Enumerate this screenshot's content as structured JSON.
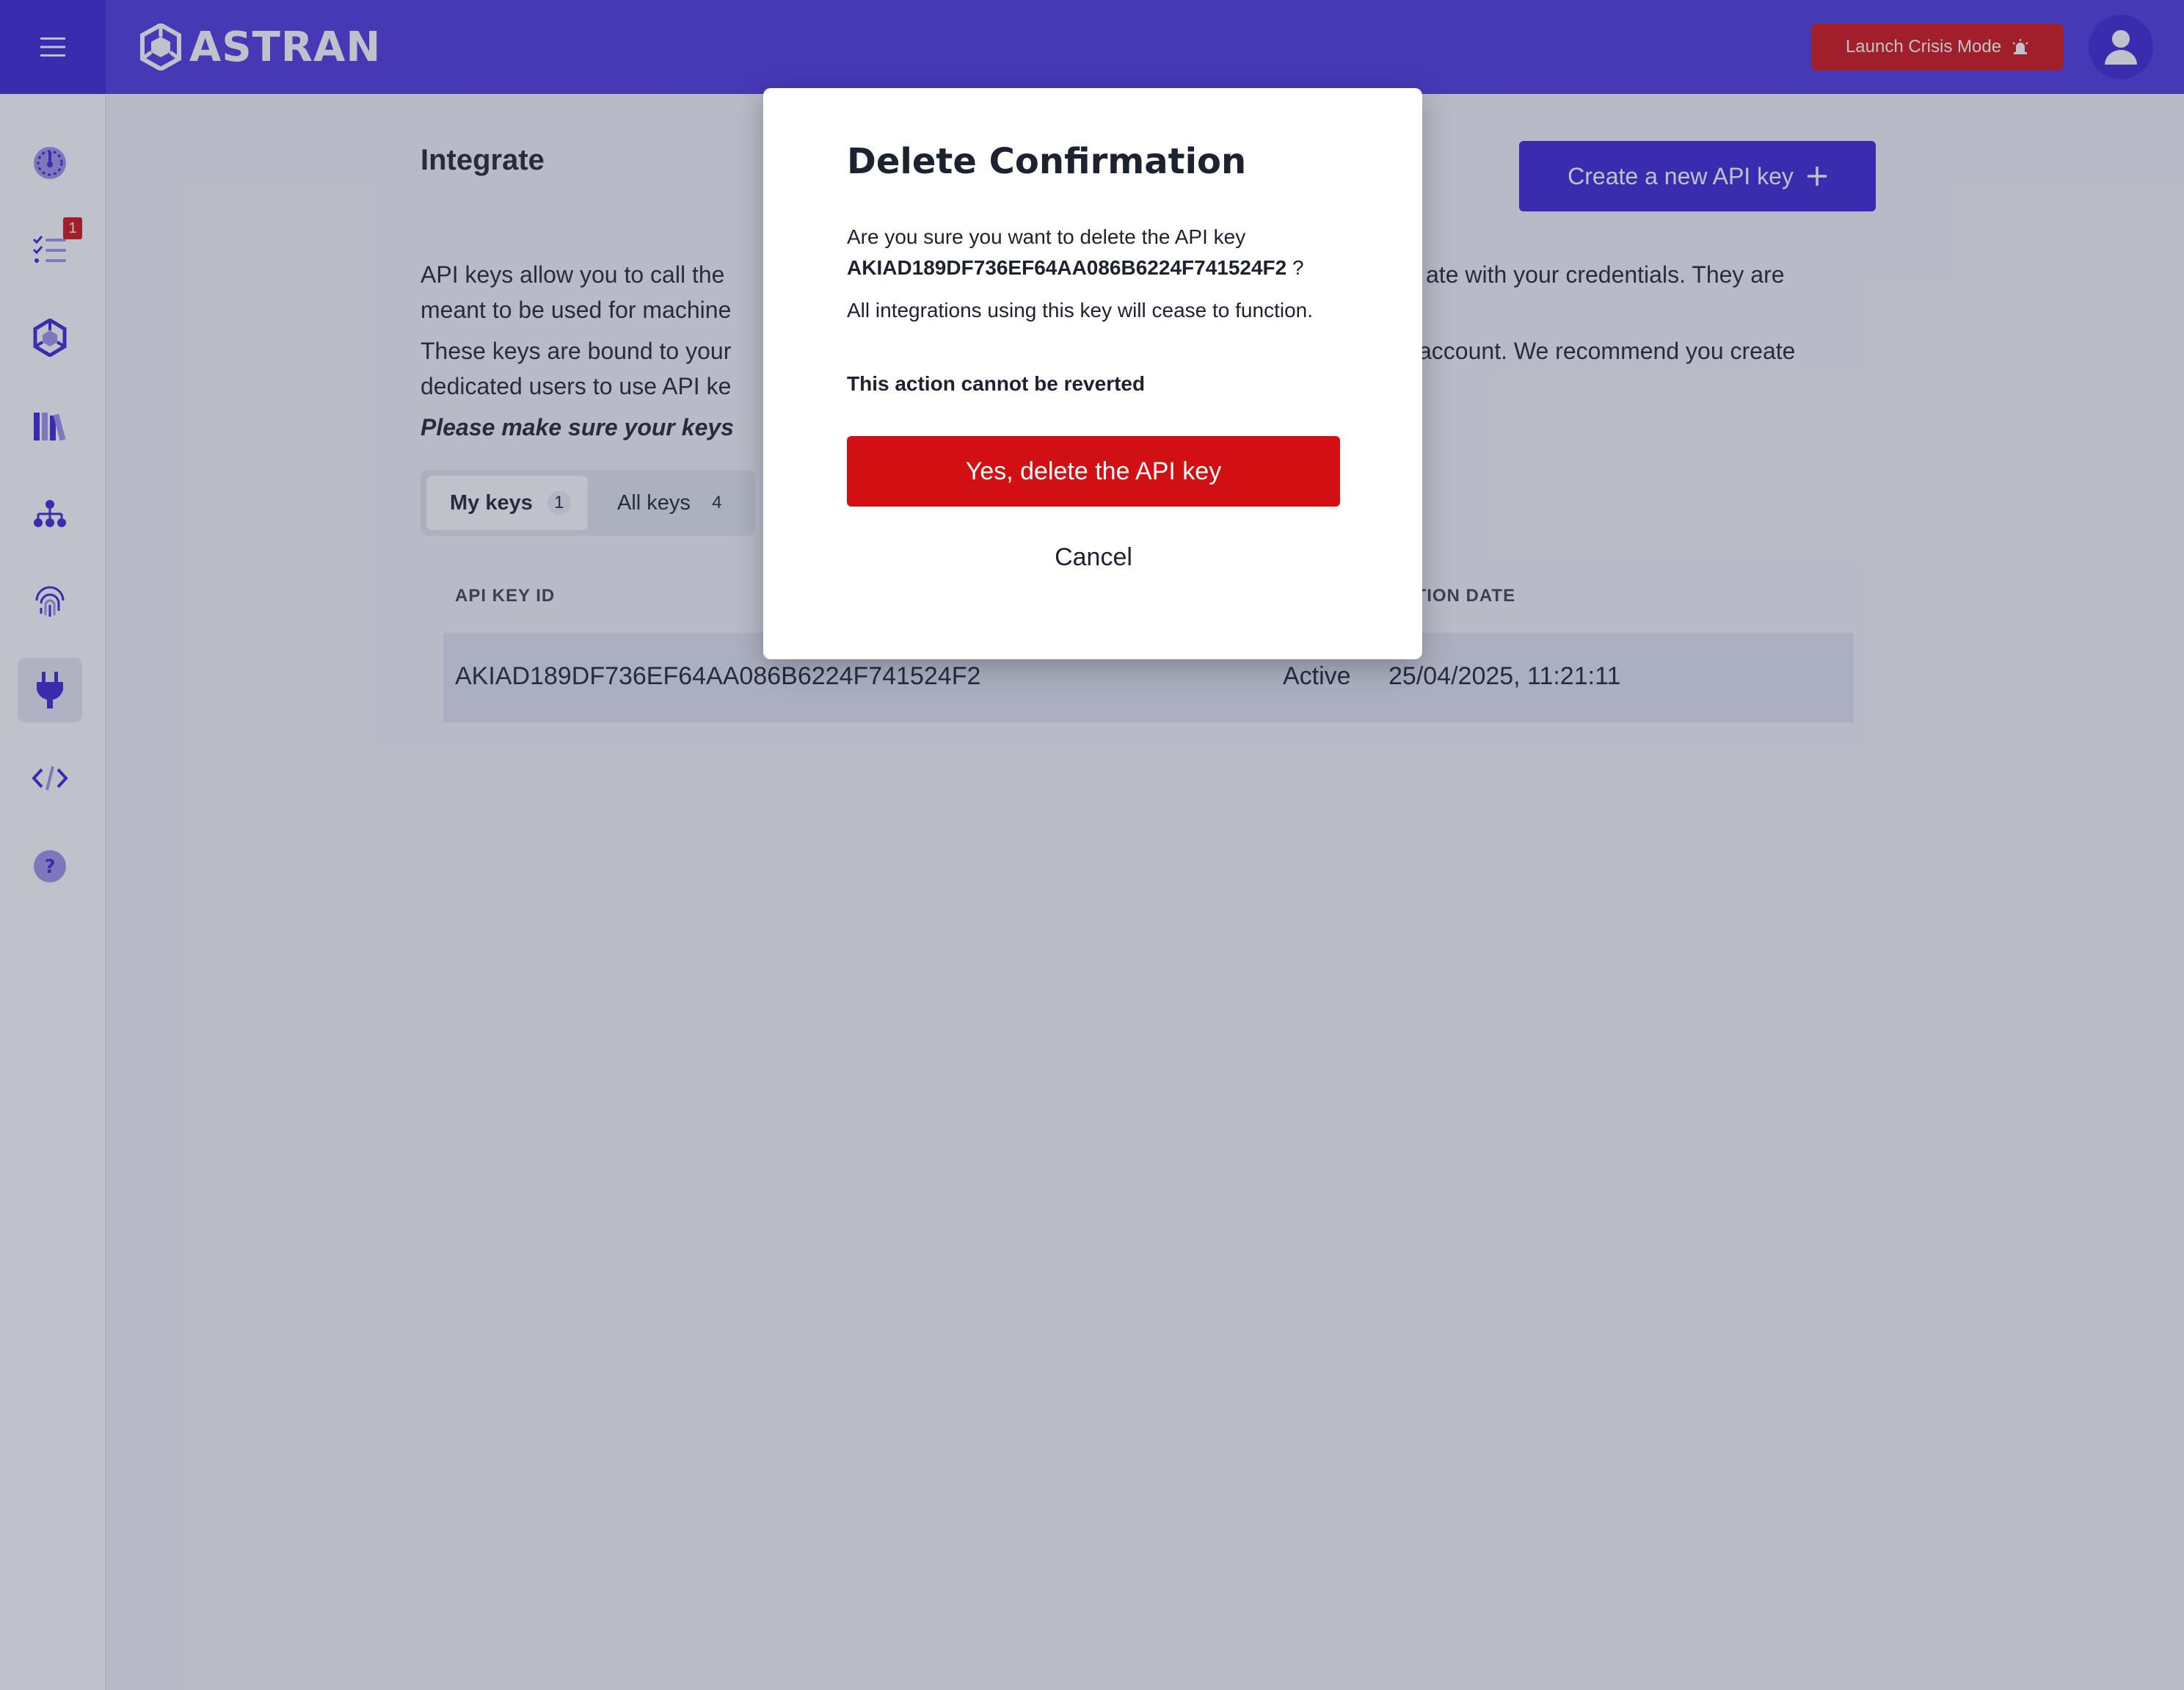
{
  "app": {
    "name": "ASTRAN"
  },
  "header": {
    "menu_icon": "hamburger-icon",
    "crisis_label": "Launch Crisis Mode",
    "crisis_icon": "alarm-icon",
    "avatar_icon": "user-icon"
  },
  "sidebar": {
    "items": [
      {
        "icon": "dashboard-gauge-icon"
      },
      {
        "icon": "checklist-icon",
        "badge": "1"
      },
      {
        "icon": "cube-network-icon"
      },
      {
        "icon": "library-books-icon"
      },
      {
        "icon": "hierarchy-icon"
      },
      {
        "icon": "fingerprint-icon"
      },
      {
        "icon": "plug-icon",
        "active": true
      },
      {
        "icon": "code-icon"
      },
      {
        "icon": "help-icon"
      }
    ]
  },
  "main": {
    "title": "Integrate",
    "create_button": "Create a new API key",
    "intro_line1": "API keys allow you to call the",
    "intro_line1_end": "ate with your credentials. They are",
    "intro_line2": "meant to be used for machine",
    "intro_line3": "These keys are bound to your",
    "intro_line3_end": "account. We recommend you create",
    "intro_line4": "dedicated users to use API ke",
    "intro_warning": "Please make sure your keys",
    "tabs": [
      {
        "label": "My keys",
        "count": "1"
      },
      {
        "label": "All keys",
        "count": "4"
      }
    ],
    "table": {
      "headers": {
        "id": "API KEY ID",
        "date": "ATION DATE"
      },
      "rows": [
        {
          "id": "AKIAD189DF736EF64AA086B6224F741524F2",
          "status": "Active",
          "date": "25/04/2025, 11:21:11"
        }
      ]
    }
  },
  "modal": {
    "title": "Delete Confirmation",
    "question": "Are you sure you want to delete the API key",
    "key_id": "AKIAD189DF736EF64AA086B6224F741524F2",
    "question_end": "?",
    "integrations_note": "All integrations using this key will cease to function.",
    "irreversible_note": "This action cannot be reverted",
    "confirm_button": "Yes, delete the API key",
    "cancel_button": "Cancel"
  },
  "colors": {
    "topbar": "#4c36e0",
    "primary": "#3a22d6",
    "danger": "#d21013"
  }
}
